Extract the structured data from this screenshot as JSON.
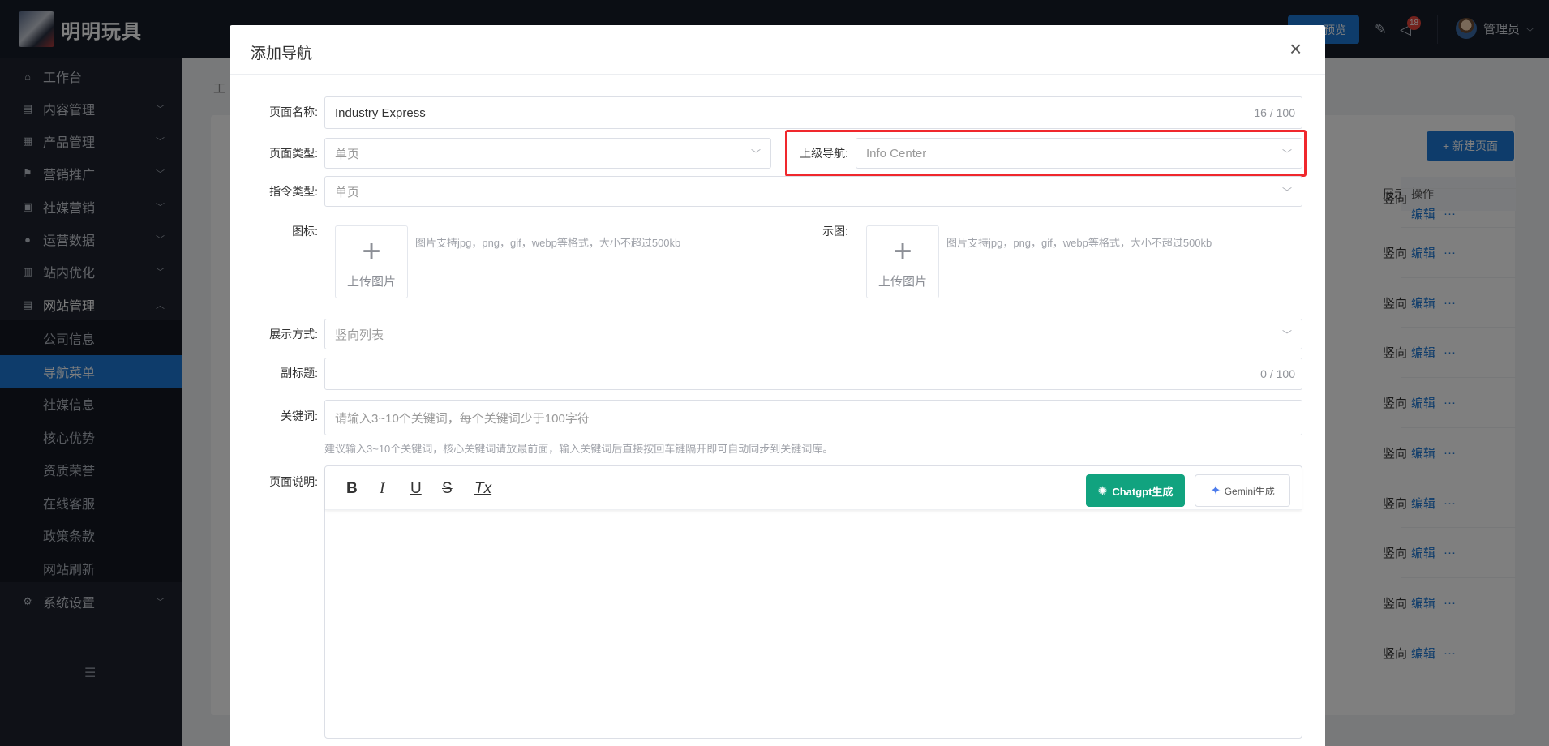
{
  "header": {
    "brand": "明明玩具",
    "preview_label": "预览",
    "notification_count": "18",
    "user_name": "管理员",
    "icons": {
      "edit": "pen-icon",
      "notify": "megaphone-icon",
      "chevron": "chevron-down-icon"
    }
  },
  "sidebar": {
    "items": [
      {
        "label": "工作台",
        "icon": "home-icon"
      },
      {
        "label": "内容管理",
        "icon": "content-icon"
      },
      {
        "label": "产品管理",
        "icon": "product-icon"
      },
      {
        "label": "营销推广",
        "icon": "flag-icon"
      },
      {
        "label": "社媒营销",
        "icon": "video-icon"
      },
      {
        "label": "运营数据",
        "icon": "chat-icon"
      },
      {
        "label": "站内优化",
        "icon": "optimize-icon"
      },
      {
        "label": "网站管理",
        "icon": "website-icon"
      }
    ],
    "sub_items": [
      "公司信息",
      "导航菜单",
      "社媒信息",
      "核心优势",
      "资质荣誉",
      "在线客服",
      "政策条款",
      "网站刷新"
    ],
    "active_sub": "导航菜单",
    "settings": {
      "label": "系统设置",
      "icon": "gear-icon"
    }
  },
  "background": {
    "breadcrumb_partial": "工",
    "new_page_label": "+ 新建页面",
    "column_header_partial": "展示",
    "ops_header": "操作",
    "cell_partial": "竖向",
    "edit_label": "编辑",
    "more_label": "···",
    "row_count": 10
  },
  "modal": {
    "title": "添加导航",
    "fields": {
      "page_name": {
        "label": "页面名称:",
        "value": "Industry Express",
        "counter": "16 / 100"
      },
      "page_type": {
        "label": "页面类型:",
        "value": "单页"
      },
      "parent_nav": {
        "label": "上级导航:",
        "value": "Info Center"
      },
      "command_type": {
        "label": "指令类型:",
        "value": "单页"
      },
      "icon": {
        "label": "图标:",
        "upload_label": "上传图片",
        "hint": "图片支持jpg，png，gif，webp等格式，大小不超过500kb"
      },
      "sample_image": {
        "label": "示图:",
        "upload_label": "上传图片",
        "hint": "图片支持jpg，png，gif，webp等格式，大小不超过500kb"
      },
      "display_mode": {
        "label": "展示方式:",
        "value": "竖向列表"
      },
      "subtitle": {
        "label": "副标题:",
        "value": "",
        "counter": "0 / 100"
      },
      "keywords": {
        "label": "关键词:",
        "placeholder": "请输入3~10个关键词，每个关键词少于100字符",
        "hint": "建议输入3~10个关键词，核心关键词请放最前面，输入关键词后直接按回车键隔开即可自动同步到关键词库。"
      },
      "description": {
        "label": "页面说明:"
      }
    },
    "editor": {
      "bold": "B",
      "italic": "I",
      "underline": "U",
      "strike": "S",
      "clear": "Tx",
      "chatgpt_label": "Chatgpt生成",
      "gemini_label": "Gemini生成"
    }
  },
  "colors": {
    "primary": "#1d79d6",
    "sidebar": "#1e232e",
    "topbar": "#171d29",
    "highlight": "#f0282d",
    "chatgpt": "#11a37f"
  }
}
